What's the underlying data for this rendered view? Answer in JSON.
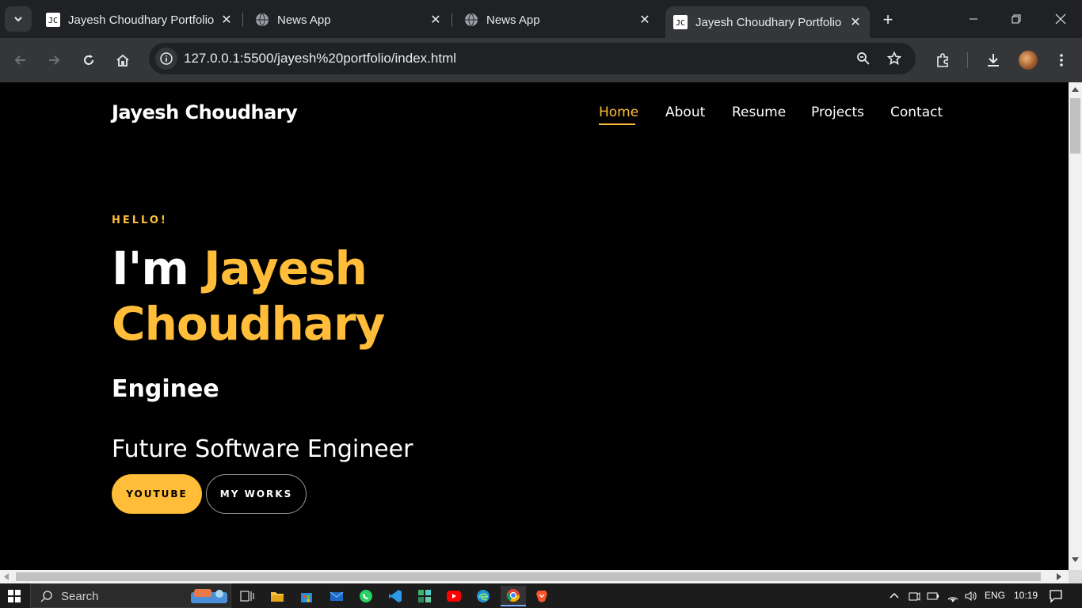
{
  "browser": {
    "tabs": [
      {
        "title": "Jayesh Choudhary Portfolio",
        "favicon": "portfolio-favicon",
        "active": false
      },
      {
        "title": "News App",
        "favicon": "globe-icon",
        "active": false
      },
      {
        "title": "News App",
        "favicon": "globe-icon",
        "active": false
      },
      {
        "title": "Jayesh Choudhary Portfolio",
        "favicon": "portfolio-favicon",
        "active": true
      }
    ],
    "url": "127.0.0.1:5500/jayesh%20portfolio/index.html"
  },
  "site": {
    "logo": "Jayesh Choudhary",
    "nav": [
      "Home",
      "About",
      "Resume",
      "Projects",
      "Contact"
    ],
    "active_nav": "Home",
    "hero": {
      "greeting": "HELLO!",
      "headline_prefix": "I'm",
      "headline_name": "Jayesh Choudhary",
      "role": "Enginee",
      "tagline": "Future Software Engineer",
      "primary_button": "YOUTUBE",
      "secondary_button": "MY WORKS"
    },
    "accent_color": "#ffbd39"
  },
  "taskbar": {
    "search_label": "Search",
    "language": "ENG",
    "time": "10:19"
  }
}
